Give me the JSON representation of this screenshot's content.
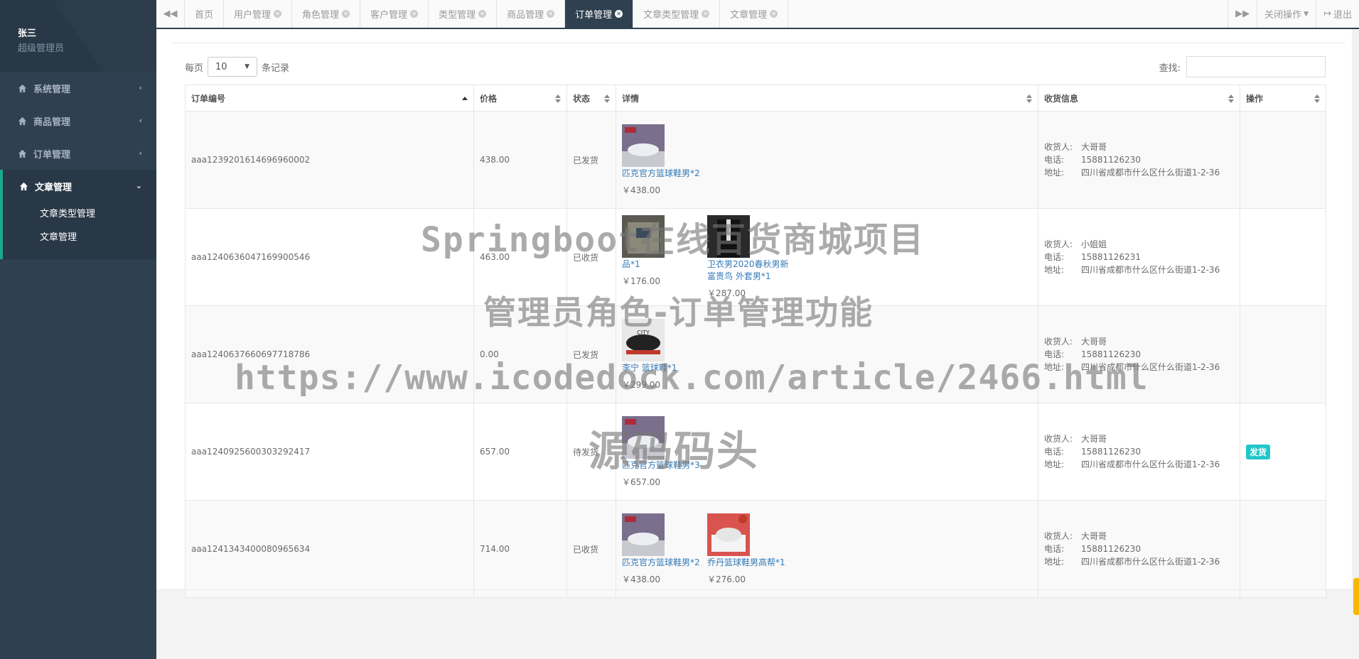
{
  "user": {
    "name": "张三",
    "role": "超级管理员"
  },
  "sidebar": {
    "items": [
      {
        "label": "系统管理"
      },
      {
        "label": "商品管理"
      },
      {
        "label": "订单管理"
      },
      {
        "label": "文章管理"
      }
    ],
    "subitems": [
      "文章类型管理",
      "文章管理"
    ]
  },
  "tabs": [
    {
      "label": "首页"
    },
    {
      "label": "用户管理"
    },
    {
      "label": "角色管理"
    },
    {
      "label": "客户管理"
    },
    {
      "label": "类型管理"
    },
    {
      "label": "商品管理"
    },
    {
      "label": "订单管理"
    },
    {
      "label": "文章类型管理"
    },
    {
      "label": "文章管理"
    }
  ],
  "tabbar_right": {
    "close_ops": "关闭操作",
    "logout": "退出"
  },
  "toolbar": {
    "per_page_prefix": "每页",
    "per_page_value": "10",
    "per_page_suffix": "条记录",
    "search_label": "查找:"
  },
  "columns": [
    "订单编号",
    "价格",
    "状态",
    "详情",
    "收货信息",
    "操作"
  ],
  "address_labels": {
    "receiver": "收货人:",
    "phone": "电话:",
    "address": "地址:"
  },
  "orders": [
    {
      "id": "aaa1239201614696960002",
      "price": "438.00",
      "status": "已发货",
      "items": [
        {
          "name": "匹克官方篮球鞋男*2",
          "price": "￥438.00"
        }
      ],
      "receiver": "大哥哥",
      "phone": "15881126230",
      "address": "四川省成都市什么区什么街道1-2-36",
      "action": ""
    },
    {
      "id": "aaa1240636047169900546",
      "price": "463.00",
      "status": "已收货",
      "items": [
        {
          "name": "卫衣男2020春秋男新富贵鸟 外套男*1",
          "price": "￥287.00"
        },
        {
          "name": "品*1",
          "price": "￥176.00"
        }
      ],
      "receiver": "小姐姐",
      "phone": "15881126231",
      "address": "四川省成都市什么区什么街道1-2-36",
      "action": ""
    },
    {
      "id": "aaa1240637660697718786",
      "price": "0.00",
      "status": "已发货",
      "items": [
        {
          "name": "李宁 篮球鞋*1",
          "price": "￥299.00"
        }
      ],
      "receiver": "大哥哥",
      "phone": "15881126230",
      "address": "四川省成都市什么区什么街道1-2-36",
      "action": ""
    },
    {
      "id": "aaa1240925600303292417",
      "price": "657.00",
      "status": "待发货",
      "items": [
        {
          "name": "匹克官方篮球鞋男*3",
          "price": "￥657.00"
        }
      ],
      "receiver": "大哥哥",
      "phone": "15881126230",
      "address": "四川省成都市什么区什么街道1-2-36",
      "action": "发货"
    },
    {
      "id": "aaa1241343400080965634",
      "price": "714.00",
      "status": "已收货",
      "items": [
        {
          "name": "匹克官方篮球鞋男*2",
          "price": "￥438.00"
        },
        {
          "name": "乔丹篮球鞋男高帮*1",
          "price": "￥276.00"
        }
      ],
      "receiver": "大哥哥",
      "phone": "15881126230",
      "address": "四川省成都市什么区什么街道1-2-36",
      "action": ""
    }
  ],
  "watermark": {
    "line1": "Springboot在线百货商城项目",
    "line2": "管理员角色-订单管理功能",
    "line3": "https://www.icodedock.com/article/2466.html",
    "line4": "源码码头"
  },
  "colors": {
    "sidebar": "#2f4050",
    "sidebar_dark": "#293846",
    "accent": "#19aa8d",
    "link": "#337ab7",
    "ship_button": "#23c6c8",
    "scroll_thumb": "#f8b800"
  }
}
